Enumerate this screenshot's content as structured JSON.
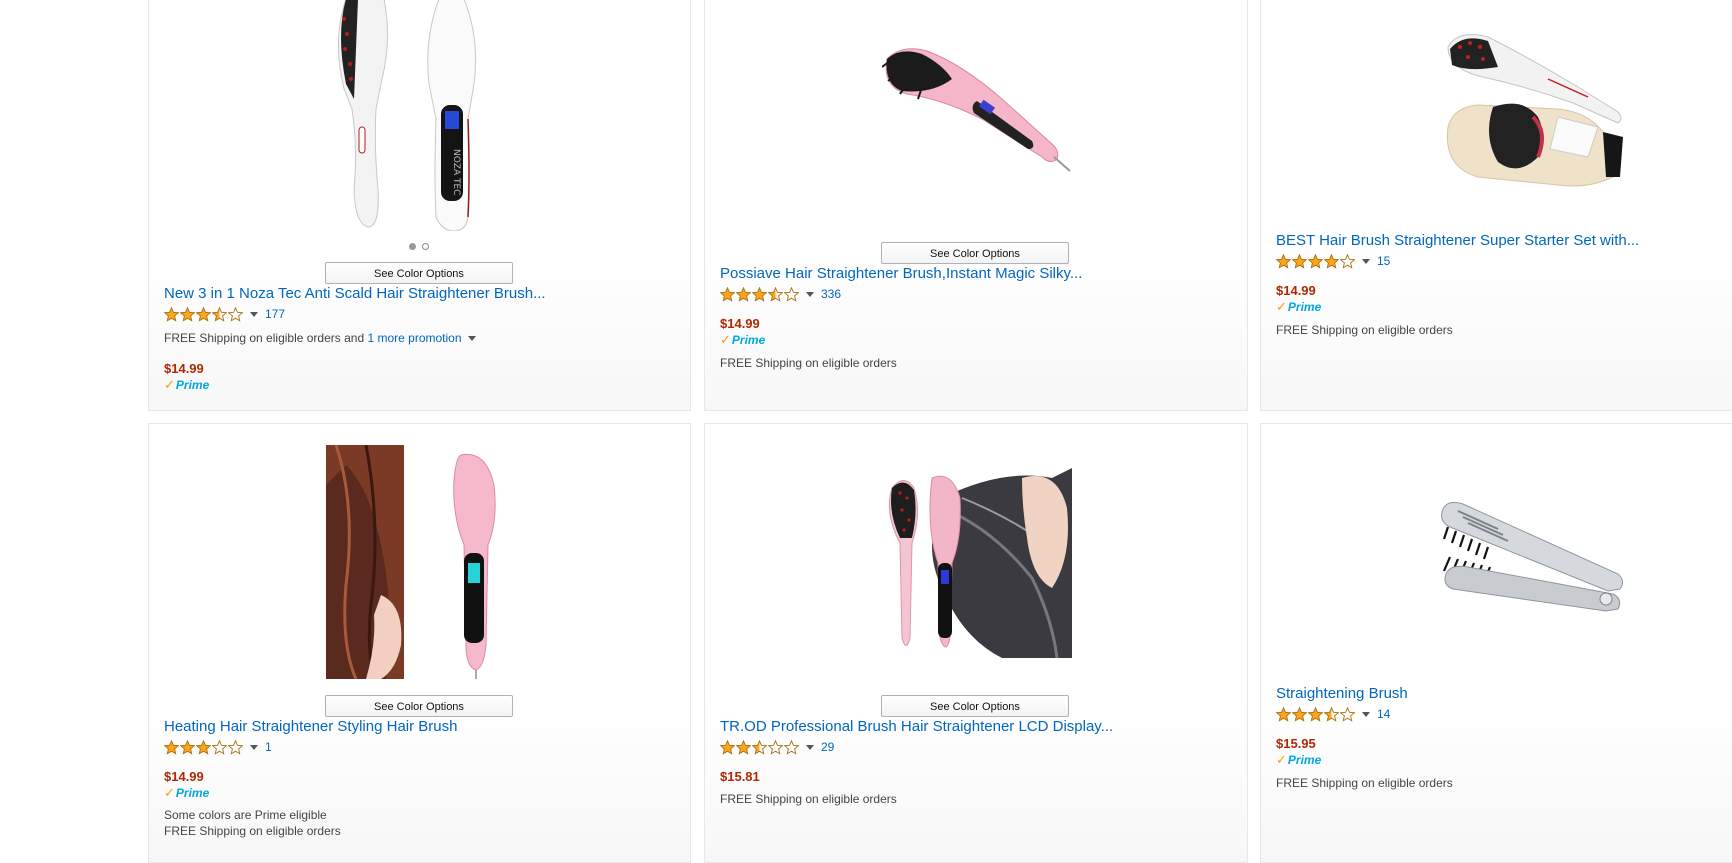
{
  "products": [
    {
      "title": "New 3 in 1 Noza Tec Anti Scald Hair Straightener Brush...",
      "rating": 3.5,
      "review_count": "177",
      "price": "$14.99",
      "prime_label": "Prime",
      "see_color_options": "See Color Options",
      "shipping": "FREE Shipping on eligible orders and ",
      "promotion_link": "1 more promotion",
      "image_dots": 2
    },
    {
      "title": "Possiave Hair Straightener Brush,Instant Magic Silky...",
      "rating": 3.5,
      "review_count": "336",
      "price": "$14.99",
      "prime_label": "Prime",
      "see_color_options": "See Color Options",
      "shipping": "FREE Shipping on eligible orders"
    },
    {
      "title": "BEST Hair Brush Straightener Super Starter Set with...",
      "rating": 4,
      "review_count": "15",
      "price": "$14.99",
      "prime_label": "Prime",
      "shipping": "FREE Shipping on eligible orders"
    },
    {
      "title": "Heating Hair Straightener Styling Hair Brush",
      "rating": 3,
      "review_count": "1",
      "price": "$14.99",
      "prime_label": "Prime",
      "see_color_options": "See Color Options",
      "prime_note": "Some colors are Prime eligible",
      "shipping": "FREE Shipping on eligible orders"
    },
    {
      "title": "TR.OD Professional Brush Hair Straightener LCD Display...",
      "rating": 2.5,
      "review_count": "29",
      "price": "$15.81",
      "see_color_options": "See Color Options",
      "shipping": "FREE Shipping on eligible orders"
    },
    {
      "title": "Straightening Brush",
      "rating": 3.5,
      "review_count": "14",
      "price": "$15.95",
      "prime_label": "Prime",
      "shipping": "FREE Shipping on eligible orders"
    }
  ],
  "colors": {
    "link": "#0066c0",
    "price": "#b12704",
    "star": "#ffa41c",
    "prime_check": "#ff9900",
    "prime_text": "#00a8e1"
  }
}
